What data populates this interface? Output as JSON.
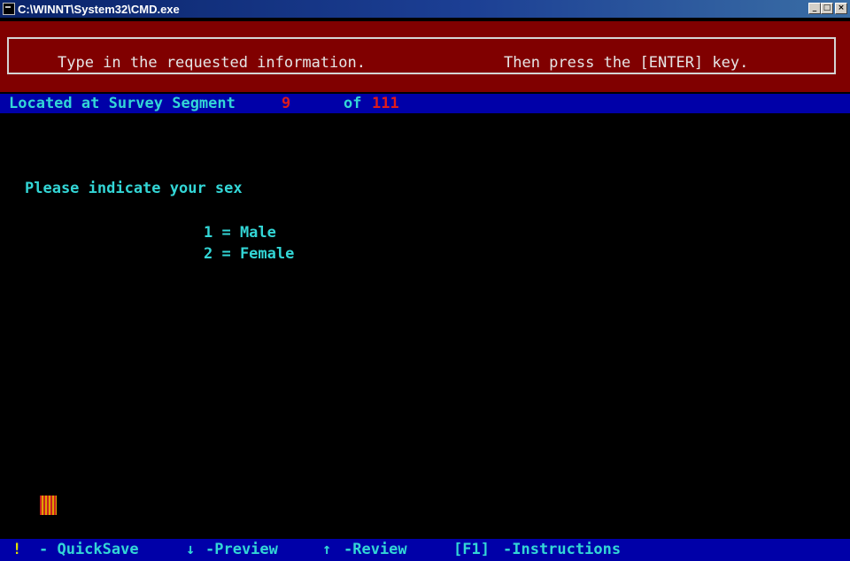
{
  "window": {
    "title": "C:\\WINNT\\System32\\CMD.exe",
    "buttons": {
      "minimize": "_",
      "maximize": "□",
      "close": "×"
    }
  },
  "banner": {
    "left_text": "Type in the requested information.",
    "right_text": "Then press the [ENTER] key."
  },
  "status": {
    "prefix": "Located at Survey Segment",
    "current_segment": "9",
    "of_label": "of",
    "total_segments": "111"
  },
  "question": {
    "prompt": "Please indicate your sex",
    "options": [
      "1 = Male",
      "2 = Female"
    ]
  },
  "footer": {
    "quicksave_key": "!",
    "quicksave_label": "- QuickSave",
    "preview_key": "↓",
    "preview_label": "-Preview",
    "review_key": "↑",
    "review_label": "-Review",
    "instructions_key": "[F1]",
    "instructions_label": "-Instructions"
  },
  "colors": {
    "banner_bg": "#800000",
    "status_bg": "#0000a8",
    "text_cyan": "#33d6d6",
    "segment_red": "#e01a1a"
  }
}
